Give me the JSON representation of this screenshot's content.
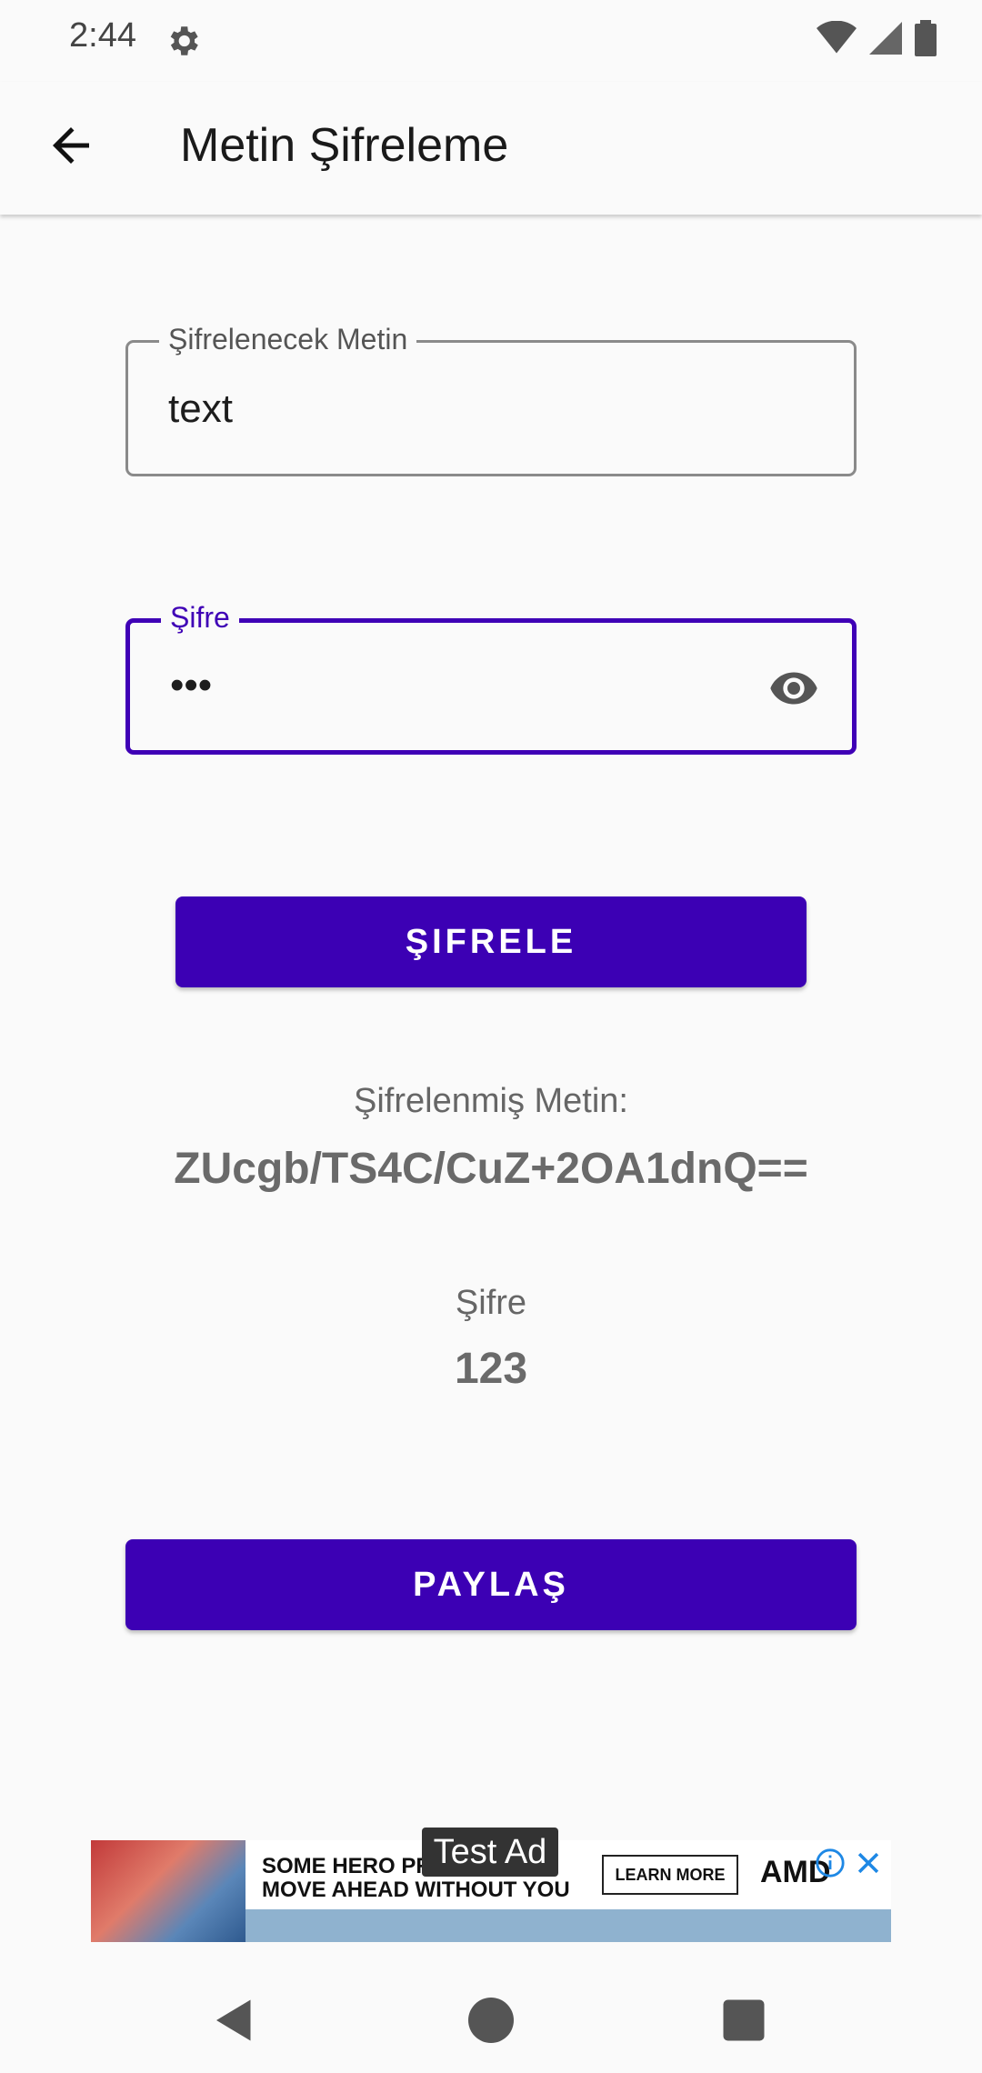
{
  "status_bar": {
    "time": "2:44",
    "icons": [
      "settings-icon",
      "wifi-icon",
      "signal-icon",
      "battery-icon"
    ]
  },
  "app_bar": {
    "title": "Metin Şifreleme",
    "back_icon": "arrow-back-icon"
  },
  "form": {
    "text_field": {
      "label": "Şifrelenecek Metin",
      "value": "text"
    },
    "password_field": {
      "label": "Şifre",
      "value": "•••",
      "toggle_icon": "eye-icon"
    },
    "encrypt_button": "ŞIFRELE"
  },
  "result": {
    "encrypted_label": "Şifrelenmiş Metin:",
    "encrypted_value": "ZUcgb/TS4C/CuZ+2OA1dnQ==",
    "password_label": "Şifre",
    "password_value": "123"
  },
  "share_button": "PAYLAŞ",
  "ad": {
    "badge": "Test Ad",
    "headline_line1": "SOME HERO PROOF IT",
    "headline_line2": "MOVE AHEAD WITHOUT YOU",
    "cta": "LEARN MORE",
    "brand": "AMD"
  },
  "colors": {
    "accent": "#3C00B4",
    "background": "#FAFAFA"
  }
}
